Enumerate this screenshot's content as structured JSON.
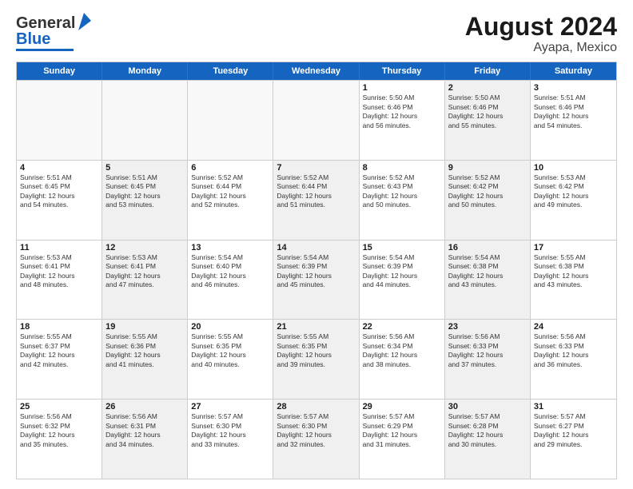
{
  "header": {
    "logo_general": "General",
    "logo_blue": "Blue",
    "title": "August 2024",
    "subtitle": "Ayapa, Mexico"
  },
  "calendar": {
    "days_of_week": [
      "Sunday",
      "Monday",
      "Tuesday",
      "Wednesday",
      "Thursday",
      "Friday",
      "Saturday"
    ],
    "rows": [
      [
        {
          "day": "",
          "info": "",
          "empty": true
        },
        {
          "day": "",
          "info": "",
          "empty": true
        },
        {
          "day": "",
          "info": "",
          "empty": true
        },
        {
          "day": "",
          "info": "",
          "empty": true
        },
        {
          "day": "1",
          "info": "Sunrise: 5:50 AM\nSunset: 6:46 PM\nDaylight: 12 hours\nand 56 minutes.",
          "shaded": false
        },
        {
          "day": "2",
          "info": "Sunrise: 5:50 AM\nSunset: 6:46 PM\nDaylight: 12 hours\nand 55 minutes.",
          "shaded": true
        },
        {
          "day": "3",
          "info": "Sunrise: 5:51 AM\nSunset: 6:46 PM\nDaylight: 12 hours\nand 54 minutes.",
          "shaded": false
        }
      ],
      [
        {
          "day": "4",
          "info": "Sunrise: 5:51 AM\nSunset: 6:45 PM\nDaylight: 12 hours\nand 54 minutes.",
          "shaded": false
        },
        {
          "day": "5",
          "info": "Sunrise: 5:51 AM\nSunset: 6:45 PM\nDaylight: 12 hours\nand 53 minutes.",
          "shaded": true
        },
        {
          "day": "6",
          "info": "Sunrise: 5:52 AM\nSunset: 6:44 PM\nDaylight: 12 hours\nand 52 minutes.",
          "shaded": false
        },
        {
          "day": "7",
          "info": "Sunrise: 5:52 AM\nSunset: 6:44 PM\nDaylight: 12 hours\nand 51 minutes.",
          "shaded": true
        },
        {
          "day": "8",
          "info": "Sunrise: 5:52 AM\nSunset: 6:43 PM\nDaylight: 12 hours\nand 50 minutes.",
          "shaded": false
        },
        {
          "day": "9",
          "info": "Sunrise: 5:52 AM\nSunset: 6:42 PM\nDaylight: 12 hours\nand 50 minutes.",
          "shaded": true
        },
        {
          "day": "10",
          "info": "Sunrise: 5:53 AM\nSunset: 6:42 PM\nDaylight: 12 hours\nand 49 minutes.",
          "shaded": false
        }
      ],
      [
        {
          "day": "11",
          "info": "Sunrise: 5:53 AM\nSunset: 6:41 PM\nDaylight: 12 hours\nand 48 minutes.",
          "shaded": false
        },
        {
          "day": "12",
          "info": "Sunrise: 5:53 AM\nSunset: 6:41 PM\nDaylight: 12 hours\nand 47 minutes.",
          "shaded": true
        },
        {
          "day": "13",
          "info": "Sunrise: 5:54 AM\nSunset: 6:40 PM\nDaylight: 12 hours\nand 46 minutes.",
          "shaded": false
        },
        {
          "day": "14",
          "info": "Sunrise: 5:54 AM\nSunset: 6:39 PM\nDaylight: 12 hours\nand 45 minutes.",
          "shaded": true
        },
        {
          "day": "15",
          "info": "Sunrise: 5:54 AM\nSunset: 6:39 PM\nDaylight: 12 hours\nand 44 minutes.",
          "shaded": false
        },
        {
          "day": "16",
          "info": "Sunrise: 5:54 AM\nSunset: 6:38 PM\nDaylight: 12 hours\nand 43 minutes.",
          "shaded": true
        },
        {
          "day": "17",
          "info": "Sunrise: 5:55 AM\nSunset: 6:38 PM\nDaylight: 12 hours\nand 43 minutes.",
          "shaded": false
        }
      ],
      [
        {
          "day": "18",
          "info": "Sunrise: 5:55 AM\nSunset: 6:37 PM\nDaylight: 12 hours\nand 42 minutes.",
          "shaded": false
        },
        {
          "day": "19",
          "info": "Sunrise: 5:55 AM\nSunset: 6:36 PM\nDaylight: 12 hours\nand 41 minutes.",
          "shaded": true
        },
        {
          "day": "20",
          "info": "Sunrise: 5:55 AM\nSunset: 6:35 PM\nDaylight: 12 hours\nand 40 minutes.",
          "shaded": false
        },
        {
          "day": "21",
          "info": "Sunrise: 5:55 AM\nSunset: 6:35 PM\nDaylight: 12 hours\nand 39 minutes.",
          "shaded": true
        },
        {
          "day": "22",
          "info": "Sunrise: 5:56 AM\nSunset: 6:34 PM\nDaylight: 12 hours\nand 38 minutes.",
          "shaded": false
        },
        {
          "day": "23",
          "info": "Sunrise: 5:56 AM\nSunset: 6:33 PM\nDaylight: 12 hours\nand 37 minutes.",
          "shaded": true
        },
        {
          "day": "24",
          "info": "Sunrise: 5:56 AM\nSunset: 6:33 PM\nDaylight: 12 hours\nand 36 minutes.",
          "shaded": false
        }
      ],
      [
        {
          "day": "25",
          "info": "Sunrise: 5:56 AM\nSunset: 6:32 PM\nDaylight: 12 hours\nand 35 minutes.",
          "shaded": false
        },
        {
          "day": "26",
          "info": "Sunrise: 5:56 AM\nSunset: 6:31 PM\nDaylight: 12 hours\nand 34 minutes.",
          "shaded": true
        },
        {
          "day": "27",
          "info": "Sunrise: 5:57 AM\nSunset: 6:30 PM\nDaylight: 12 hours\nand 33 minutes.",
          "shaded": false
        },
        {
          "day": "28",
          "info": "Sunrise: 5:57 AM\nSunset: 6:30 PM\nDaylight: 12 hours\nand 32 minutes.",
          "shaded": true
        },
        {
          "day": "29",
          "info": "Sunrise: 5:57 AM\nSunset: 6:29 PM\nDaylight: 12 hours\nand 31 minutes.",
          "shaded": false
        },
        {
          "day": "30",
          "info": "Sunrise: 5:57 AM\nSunset: 6:28 PM\nDaylight: 12 hours\nand 30 minutes.",
          "shaded": true
        },
        {
          "day": "31",
          "info": "Sunrise: 5:57 AM\nSunset: 6:27 PM\nDaylight: 12 hours\nand 29 minutes.",
          "shaded": false
        }
      ]
    ]
  }
}
